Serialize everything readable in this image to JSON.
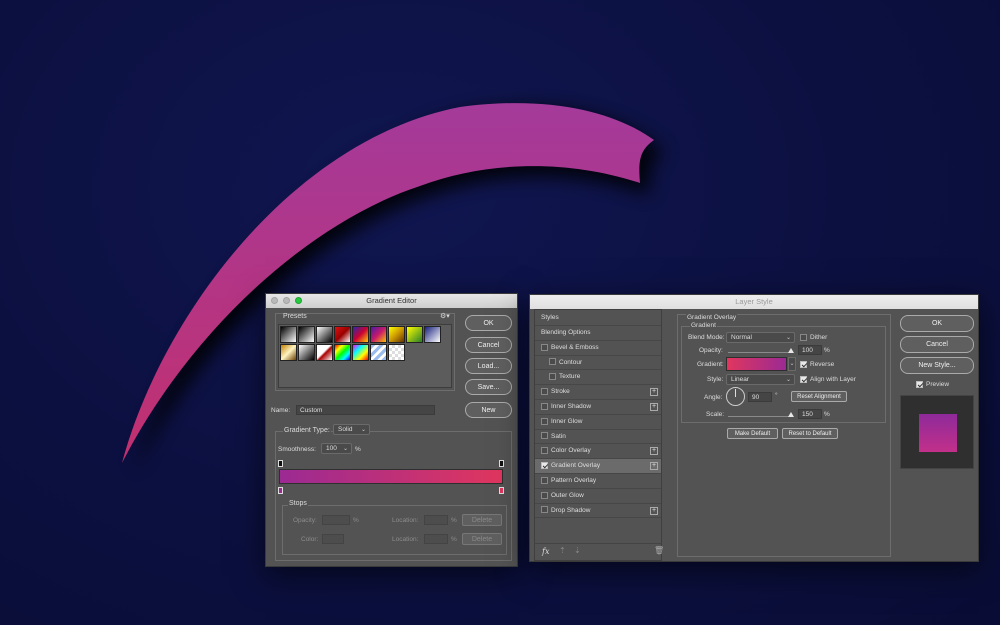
{
  "canvas": {
    "background_color": "#0c1040",
    "stroke_color": "#a8358f"
  },
  "gradient_editor": {
    "title": "Gradient Editor",
    "presets_label": "Presets",
    "buttons": {
      "ok": "OK",
      "cancel": "Cancel",
      "load": "Load...",
      "save": "Save...",
      "new": "New"
    },
    "name_label": "Name:",
    "name_value": "Custom",
    "gradient_type_label": "Gradient Type:",
    "gradient_type_value": "Solid",
    "smoothness_label": "Smoothness:",
    "smoothness_value": "100",
    "smoothness_unit": "%",
    "gradient_colors": [
      "#9b2a93",
      "#e0365e"
    ],
    "stops": {
      "title": "Stops",
      "opacity_label": "Opacity:",
      "opacity_unit": "%",
      "location_label": "Location:",
      "location_unit": "%",
      "delete_label": "Delete",
      "color_label": "Color:"
    },
    "preset_swatches": [
      "linear-gradient(135deg,#000,#fff)",
      "linear-gradient(135deg,#000,#fff)",
      "linear-gradient(135deg,#fff,#000)",
      "linear-gradient(135deg,#d11,#900,#fff)",
      "linear-gradient(135deg,#2a2aa8,#c03,#fc0)",
      "linear-gradient(135deg,#4b1aa5,#c91a6a,#f8c300)",
      "linear-gradient(135deg,#ff0,#c90,#630)",
      "linear-gradient(135deg,#ff0,#2a7f2a)",
      "linear-gradient(135deg,#1a237e,#fff)",
      "linear-gradient(135deg,#c28000,#fff4c2,#6b3f00)",
      "linear-gradient(135deg,#fff,#000)",
      "linear-gradient(135deg,#fff 45%,#a00 55%,#fff)",
      "linear-gradient(135deg,#f00,#ff0,#0f0,#0ff,#00f)",
      "linear-gradient(135deg,#f0f,#0ff,#ff0,#f00)",
      "repeating-linear-gradient(135deg,#9be 0 3px,#fff 3px 6px)",
      "repeating-conic-gradient(#ddd 0 25%,#fff 0 50%)"
    ]
  },
  "layer_style": {
    "title": "Layer Style",
    "styles_header": "Styles",
    "list_items": [
      {
        "label": "Blending Options",
        "checkbox": false,
        "checked": false,
        "plus": false,
        "indent": false,
        "selected": false
      },
      {
        "label": "Bevel & Emboss",
        "checkbox": true,
        "checked": false,
        "plus": false,
        "indent": false,
        "selected": false
      },
      {
        "label": "Contour",
        "checkbox": true,
        "checked": false,
        "plus": false,
        "indent": true,
        "selected": false
      },
      {
        "label": "Texture",
        "checkbox": true,
        "checked": false,
        "plus": false,
        "indent": true,
        "selected": false
      },
      {
        "label": "Stroke",
        "checkbox": true,
        "checked": false,
        "plus": true,
        "indent": false,
        "selected": false
      },
      {
        "label": "Inner Shadow",
        "checkbox": true,
        "checked": false,
        "plus": true,
        "indent": false,
        "selected": false
      },
      {
        "label": "Inner Glow",
        "checkbox": true,
        "checked": false,
        "plus": false,
        "indent": false,
        "selected": false
      },
      {
        "label": "Satin",
        "checkbox": true,
        "checked": false,
        "plus": false,
        "indent": false,
        "selected": false
      },
      {
        "label": "Color Overlay",
        "checkbox": true,
        "checked": false,
        "plus": true,
        "indent": false,
        "selected": false
      },
      {
        "label": "Gradient Overlay",
        "checkbox": true,
        "checked": true,
        "plus": true,
        "indent": false,
        "selected": true
      },
      {
        "label": "Pattern Overlay",
        "checkbox": true,
        "checked": false,
        "plus": false,
        "indent": false,
        "selected": false
      },
      {
        "label": "Outer Glow",
        "checkbox": true,
        "checked": false,
        "plus": false,
        "indent": false,
        "selected": false
      },
      {
        "label": "Drop Shadow",
        "checkbox": true,
        "checked": false,
        "plus": true,
        "indent": false,
        "selected": false
      }
    ],
    "fx_label": "fx",
    "section_title": "Gradient Overlay",
    "subsection_title": "Gradient",
    "blend_mode_label": "Blend Mode:",
    "blend_mode_value": "Normal",
    "dither_label": "Dither",
    "opacity_label": "Opacity:",
    "opacity_value": "100",
    "opacity_unit": "%",
    "gradient_label": "Gradient:",
    "reverse_label": "Reverse",
    "style_label": "Style:",
    "style_value": "Linear",
    "align_label": "Align with Layer",
    "angle_label": "Angle:",
    "angle_value": "90",
    "angle_unit": "°",
    "reset_alignment_label": "Reset Alignment",
    "scale_label": "Scale:",
    "scale_value": "150",
    "scale_unit": "%",
    "make_default_label": "Make Default",
    "reset_default_label": "Reset to Default",
    "buttons": {
      "ok": "OK",
      "cancel": "Cancel",
      "new_style": "New Style..."
    },
    "preview_label": "Preview",
    "preview_colors": [
      "#c2308a",
      "#8e2a9a"
    ]
  }
}
